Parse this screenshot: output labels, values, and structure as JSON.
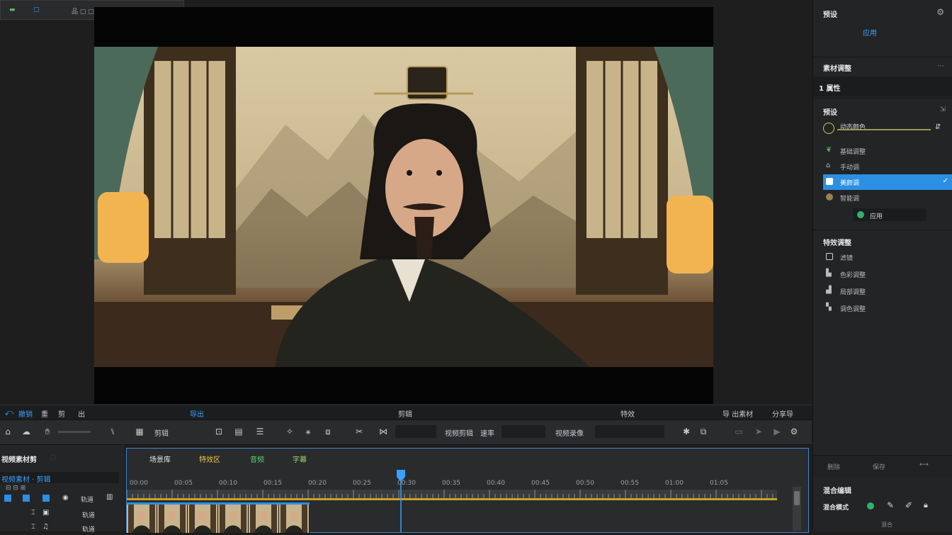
{
  "topbar": {
    "item1": "▢",
    "item2": "品 ▢ ▢",
    "item3": "▢ ▢ ▢ ▢ ▢ ▢ ▢ ▢"
  },
  "right_panel": {
    "top_title": "预设",
    "top_btn": "应用",
    "section_adjust": "素材调整",
    "adjust_tab": "1 属性",
    "section_style": "预设",
    "slider_label": "动态颜色",
    "items": [
      {
        "icon": "leaf-icon",
        "label": "基础调整"
      },
      {
        "icon": "home-icon",
        "label": "手动调"
      },
      {
        "icon": "square-icon",
        "label": "美颜调",
        "selected": true
      },
      {
        "icon": "circle-icon",
        "label": "智能调"
      }
    ],
    "apply_btn": "应用",
    "section_effects": "特效调整",
    "effects": [
      {
        "icon": "square-outline-icon",
        "label": "滤镜"
      },
      {
        "icon": "chart-icon",
        "label": "色彩调整"
      },
      {
        "icon": "building-icon",
        "label": "局部调整"
      },
      {
        "icon": "layers-icon",
        "label": "调色调整"
      }
    ],
    "bottom_btn1": "删除",
    "bottom_btn2": "保存",
    "bottom_title": "混合编辑",
    "bottom_label": "混合模式",
    "bottom_footer": "混合"
  },
  "toolbar_top": {
    "left1": "撤销",
    "left2": "重",
    "left3": "剪",
    "left4": "出",
    "left5": "导出",
    "center": "剪辑",
    "right_center": "特效",
    "right1": "导 出素材",
    "right2": "分享导"
  },
  "toolbar_main": {
    "t1": "剪辑",
    "t2": "视频剪辑",
    "t3": "速率",
    "t4": "视频录像"
  },
  "timeline": {
    "left_title": "视频素材剪",
    "left_sub": "视频素材 · 剪辑",
    "left_label": "轨道",
    "left_row1": "轨道",
    "left_row2": "轨道",
    "tabs": [
      "场景库",
      "特效区",
      "音频",
      "字幕"
    ],
    "ruler": [
      "00:00",
      "00:05",
      "00:10",
      "00:15",
      "00:20",
      "00:25",
      "00:30",
      "00:35",
      "00:40",
      "00:45",
      "00:50",
      "00:55",
      "01:00",
      "01:05"
    ]
  },
  "colors": {
    "accent": "#2b8fe3",
    "playhead": "#3aa0ff",
    "track_line": "#c9a227"
  }
}
